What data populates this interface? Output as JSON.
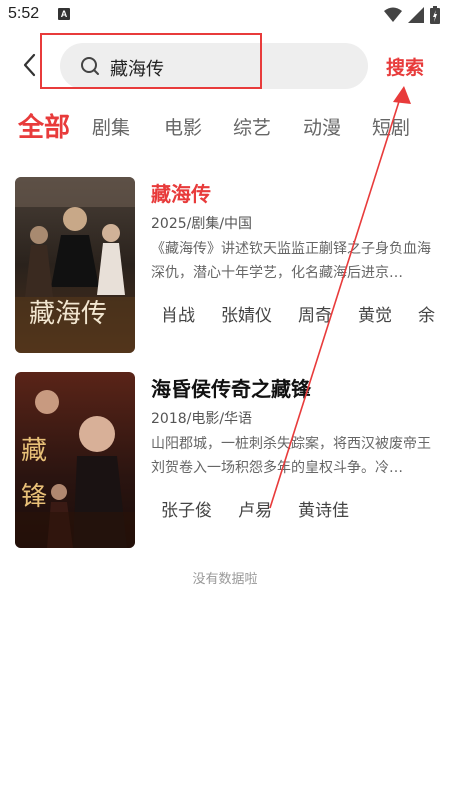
{
  "status_bar": {
    "time": "5:52",
    "notif_letter": "A"
  },
  "search": {
    "query": "藏海传",
    "button_label": "搜索"
  },
  "tabs": [
    {
      "label": "全部",
      "active": true
    },
    {
      "label": "剧集",
      "active": false
    },
    {
      "label": "电影",
      "active": false
    },
    {
      "label": "综艺",
      "active": false
    },
    {
      "label": "动漫",
      "active": false
    },
    {
      "label": "短剧",
      "active": false
    }
  ],
  "results": [
    {
      "title": "藏海传",
      "meta": "2025/剧集/中国",
      "desc": "《藏海传》讲述钦天监监正蒯铎之子身负血海深仇，潜心十年学艺，化名藏海后进京…",
      "cast": [
        "肖战",
        "张婧仪",
        "周奇",
        "黄觉",
        "余"
      ],
      "poster_text": "藏海传"
    },
    {
      "title": "海昏侯传奇之藏锋",
      "meta": "2018/电影/华语",
      "desc": "山阳郡城，一桩刺杀失踪案，将西汉被废帝王刘贺卷入一场积怨多年的皇权斗争。冷…",
      "cast": [
        "张子俊",
        "卢易",
        "黄诗佳"
      ],
      "poster_text": "藏锋"
    }
  ],
  "empty_message": "没有数据啦",
  "colors": {
    "accent": "#e83b3b",
    "search_bg": "#eeeeee"
  }
}
